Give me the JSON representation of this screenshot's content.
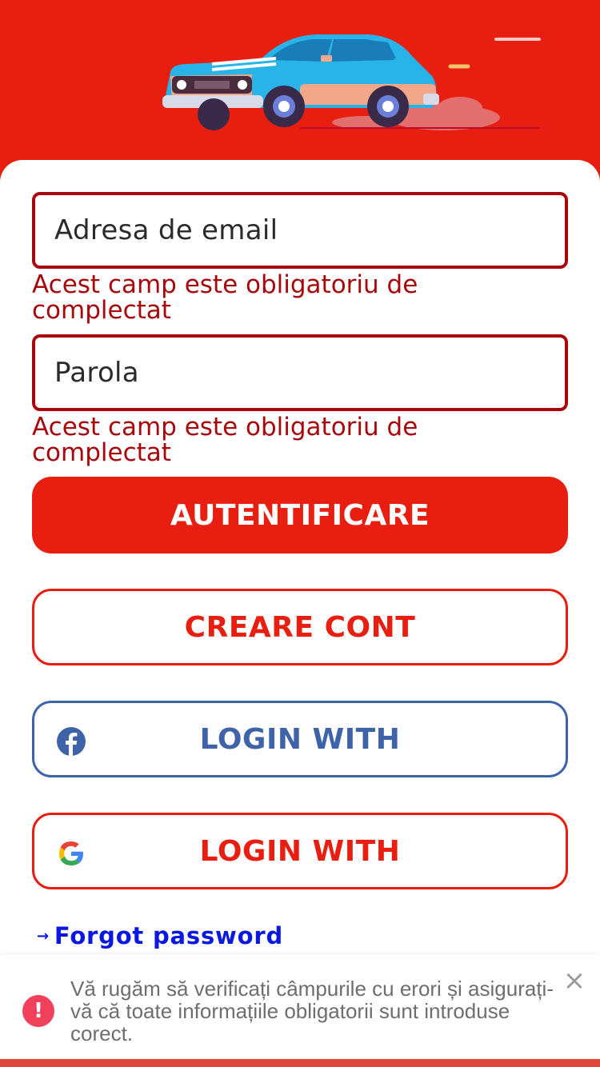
{
  "colors": {
    "brand_red": "#E81E10",
    "error_red": "#A8080C",
    "facebook_blue": "#3F63A8",
    "link_blue": "#0A18E0",
    "toast_error_icon": "#F0405A"
  },
  "header": {
    "illustration": "car-illustration",
    "menu_icon": "menu-line-icon"
  },
  "form": {
    "email_placeholder": "Adresa de email",
    "email_error": "Acest camp este obligatoriu de complectat",
    "password_placeholder": "Parola",
    "password_error": "Acest camp este obligatoriu de complectat"
  },
  "buttons": {
    "login": "AUTENTIFICARE",
    "create_account": "CREARE CONT",
    "facebook_login": "LOGIN WITH",
    "google_login": "LOGIN WITH"
  },
  "links": {
    "forgot_password": "Forgot password",
    "forgot_arrow": "→"
  },
  "toast": {
    "icon": "!",
    "message": "Vă rugăm să verificați câmpurile cu erori și asigurați-vă că toate informațiile obligatorii sunt introduse corect.",
    "close": "×"
  }
}
